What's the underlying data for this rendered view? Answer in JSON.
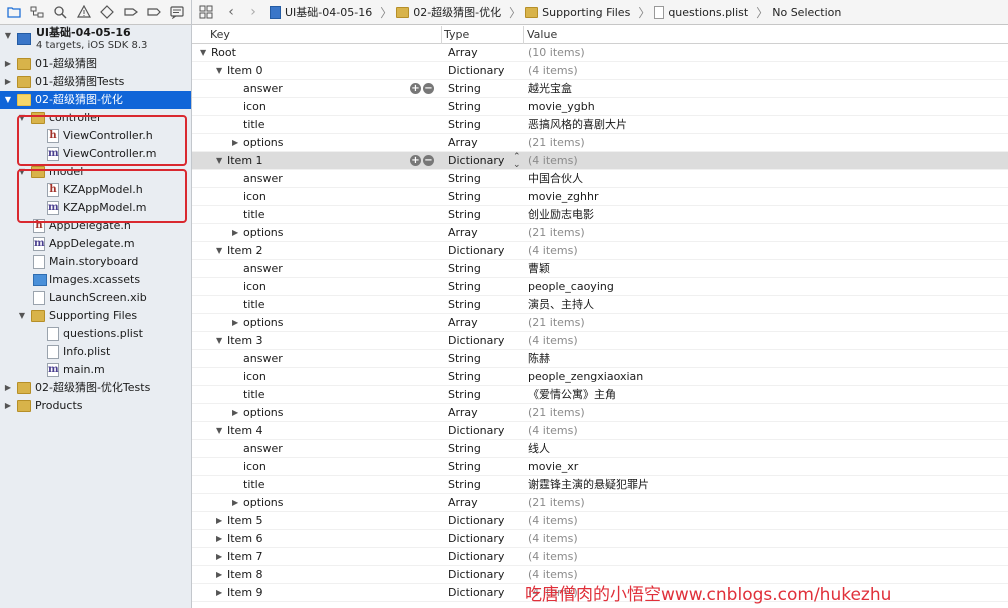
{
  "navigator": {
    "toolbar_icons": [
      "folder-icon",
      "hierarchy-icon",
      "search-icon",
      "warning-icon",
      "test-icon",
      "debug-icon",
      "breakpoint-icon",
      "log-icon"
    ],
    "project": {
      "title": "UI基础-04-05-16",
      "subtitle": "4 targets, iOS SDK 8.3"
    },
    "items": [
      {
        "label": "01-超级猜图",
        "kind": "folder",
        "level": 1,
        "tri": "right"
      },
      {
        "label": "01-超级猜图Tests",
        "kind": "folder",
        "level": 1,
        "tri": "right"
      },
      {
        "label": "02-超级猜图-优化",
        "kind": "folder",
        "level": 1,
        "tri": "down",
        "selected": true
      },
      {
        "label": "controller",
        "kind": "folder",
        "level": 2,
        "tri": "down"
      },
      {
        "label": "ViewController.h",
        "kind": "h",
        "level": 3
      },
      {
        "label": "ViewController.m",
        "kind": "m",
        "level": 3
      },
      {
        "label": "model",
        "kind": "folder",
        "level": 2,
        "tri": "down"
      },
      {
        "label": "KZAppModel.h",
        "kind": "h",
        "level": 3
      },
      {
        "label": "KZAppModel.m",
        "kind": "m",
        "level": 3
      },
      {
        "label": "AppDelegate.h",
        "kind": "h",
        "level": 2
      },
      {
        "label": "AppDelegate.m",
        "kind": "m",
        "level": 2
      },
      {
        "label": "Main.storyboard",
        "kind": "generic",
        "level": 2
      },
      {
        "label": "Images.xcassets",
        "kind": "xcassets",
        "level": 2
      },
      {
        "label": "LaunchScreen.xib",
        "kind": "generic",
        "level": 2
      },
      {
        "label": "Supporting Files",
        "kind": "folder",
        "level": 2,
        "tri": "down"
      },
      {
        "label": "questions.plist",
        "kind": "generic",
        "level": 3
      },
      {
        "label": "Info.plist",
        "kind": "generic",
        "level": 3
      },
      {
        "label": "main.m",
        "kind": "m",
        "level": 3
      },
      {
        "label": "02-超级猜图-优化Tests",
        "kind": "folder",
        "level": 1,
        "tri": "right"
      },
      {
        "label": "Products",
        "kind": "folder",
        "level": 1,
        "tri": "right"
      }
    ]
  },
  "jumpbar": {
    "back": "‹",
    "forward": "›",
    "crumbs": [
      "UI基础-04-05-16",
      "02-超级猜图-优化",
      "Supporting Files",
      "questions.plist",
      "No Selection"
    ]
  },
  "plist": {
    "headers": {
      "key": "Key",
      "type": "Type",
      "value": "Value"
    },
    "rows": [
      {
        "key": "Root",
        "indent": 0,
        "tri": "down",
        "type": "Array",
        "value": "(10 items)",
        "muted": true
      },
      {
        "key": "Item 0",
        "indent": 1,
        "tri": "down",
        "type": "Dictionary",
        "value": "(4 items)",
        "muted": true
      },
      {
        "key": "answer",
        "indent": 2,
        "type": "String",
        "value": "越光宝盒",
        "controls": true
      },
      {
        "key": "icon",
        "indent": 2,
        "type": "String",
        "value": "movie_ygbh"
      },
      {
        "key": "title",
        "indent": 2,
        "type": "String",
        "value": "恶搞风格的喜剧大片"
      },
      {
        "key": "options",
        "indent": 2,
        "tri": "right",
        "type": "Array",
        "value": "(21 items)",
        "muted": true
      },
      {
        "key": "Item 1",
        "indent": 1,
        "tri": "down",
        "type": "Dictionary",
        "value": "(4 items)",
        "muted": true,
        "selected": true,
        "controls": true,
        "stepper": true
      },
      {
        "key": "answer",
        "indent": 2,
        "type": "String",
        "value": "中国合伙人"
      },
      {
        "key": "icon",
        "indent": 2,
        "type": "String",
        "value": "movie_zghhr"
      },
      {
        "key": "title",
        "indent": 2,
        "type": "String",
        "value": "创业励志电影"
      },
      {
        "key": "options",
        "indent": 2,
        "tri": "right",
        "type": "Array",
        "value": "(21 items)",
        "muted": true
      },
      {
        "key": "Item 2",
        "indent": 1,
        "tri": "down",
        "type": "Dictionary",
        "value": "(4 items)",
        "muted": true
      },
      {
        "key": "answer",
        "indent": 2,
        "type": "String",
        "value": "曹颖"
      },
      {
        "key": "icon",
        "indent": 2,
        "type": "String",
        "value": "people_caoying"
      },
      {
        "key": "title",
        "indent": 2,
        "type": "String",
        "value": "演员、主持人"
      },
      {
        "key": "options",
        "indent": 2,
        "tri": "right",
        "type": "Array",
        "value": "(21 items)",
        "muted": true
      },
      {
        "key": "Item 3",
        "indent": 1,
        "tri": "down",
        "type": "Dictionary",
        "value": "(4 items)",
        "muted": true
      },
      {
        "key": "answer",
        "indent": 2,
        "type": "String",
        "value": "陈赫"
      },
      {
        "key": "icon",
        "indent": 2,
        "type": "String",
        "value": "people_zengxiaoxian"
      },
      {
        "key": "title",
        "indent": 2,
        "type": "String",
        "value": "《爱情公寓》主角"
      },
      {
        "key": "options",
        "indent": 2,
        "tri": "right",
        "type": "Array",
        "value": "(21 items)",
        "muted": true
      },
      {
        "key": "Item 4",
        "indent": 1,
        "tri": "down",
        "type": "Dictionary",
        "value": "(4 items)",
        "muted": true
      },
      {
        "key": "answer",
        "indent": 2,
        "type": "String",
        "value": "线人"
      },
      {
        "key": "icon",
        "indent": 2,
        "type": "String",
        "value": "movie_xr"
      },
      {
        "key": "title",
        "indent": 2,
        "type": "String",
        "value": "谢霆锋主演的悬疑犯罪片"
      },
      {
        "key": "options",
        "indent": 2,
        "tri": "right",
        "type": "Array",
        "value": "(21 items)",
        "muted": true
      },
      {
        "key": "Item 5",
        "indent": 1,
        "tri": "right",
        "type": "Dictionary",
        "value": "(4 items)",
        "muted": true
      },
      {
        "key": "Item 6",
        "indent": 1,
        "tri": "right",
        "type": "Dictionary",
        "value": "(4 items)",
        "muted": true
      },
      {
        "key": "Item 7",
        "indent": 1,
        "tri": "right",
        "type": "Dictionary",
        "value": "(4 items)",
        "muted": true
      },
      {
        "key": "Item 8",
        "indent": 1,
        "tri": "right",
        "type": "Dictionary",
        "value": "(4 items)",
        "muted": true
      },
      {
        "key": "Item 9",
        "indent": 1,
        "tri": "right",
        "type": "Dictionary",
        "value": "(4 items)",
        "muted": true
      }
    ]
  },
  "watermark": "吃唐僧肉的小悟空www.cnblogs.com/hukezhu",
  "colors": {
    "selection": "#1065d8",
    "highlight_border": "#d9282f",
    "folder": "#d8b34a",
    "watermark": "#e0303a"
  }
}
